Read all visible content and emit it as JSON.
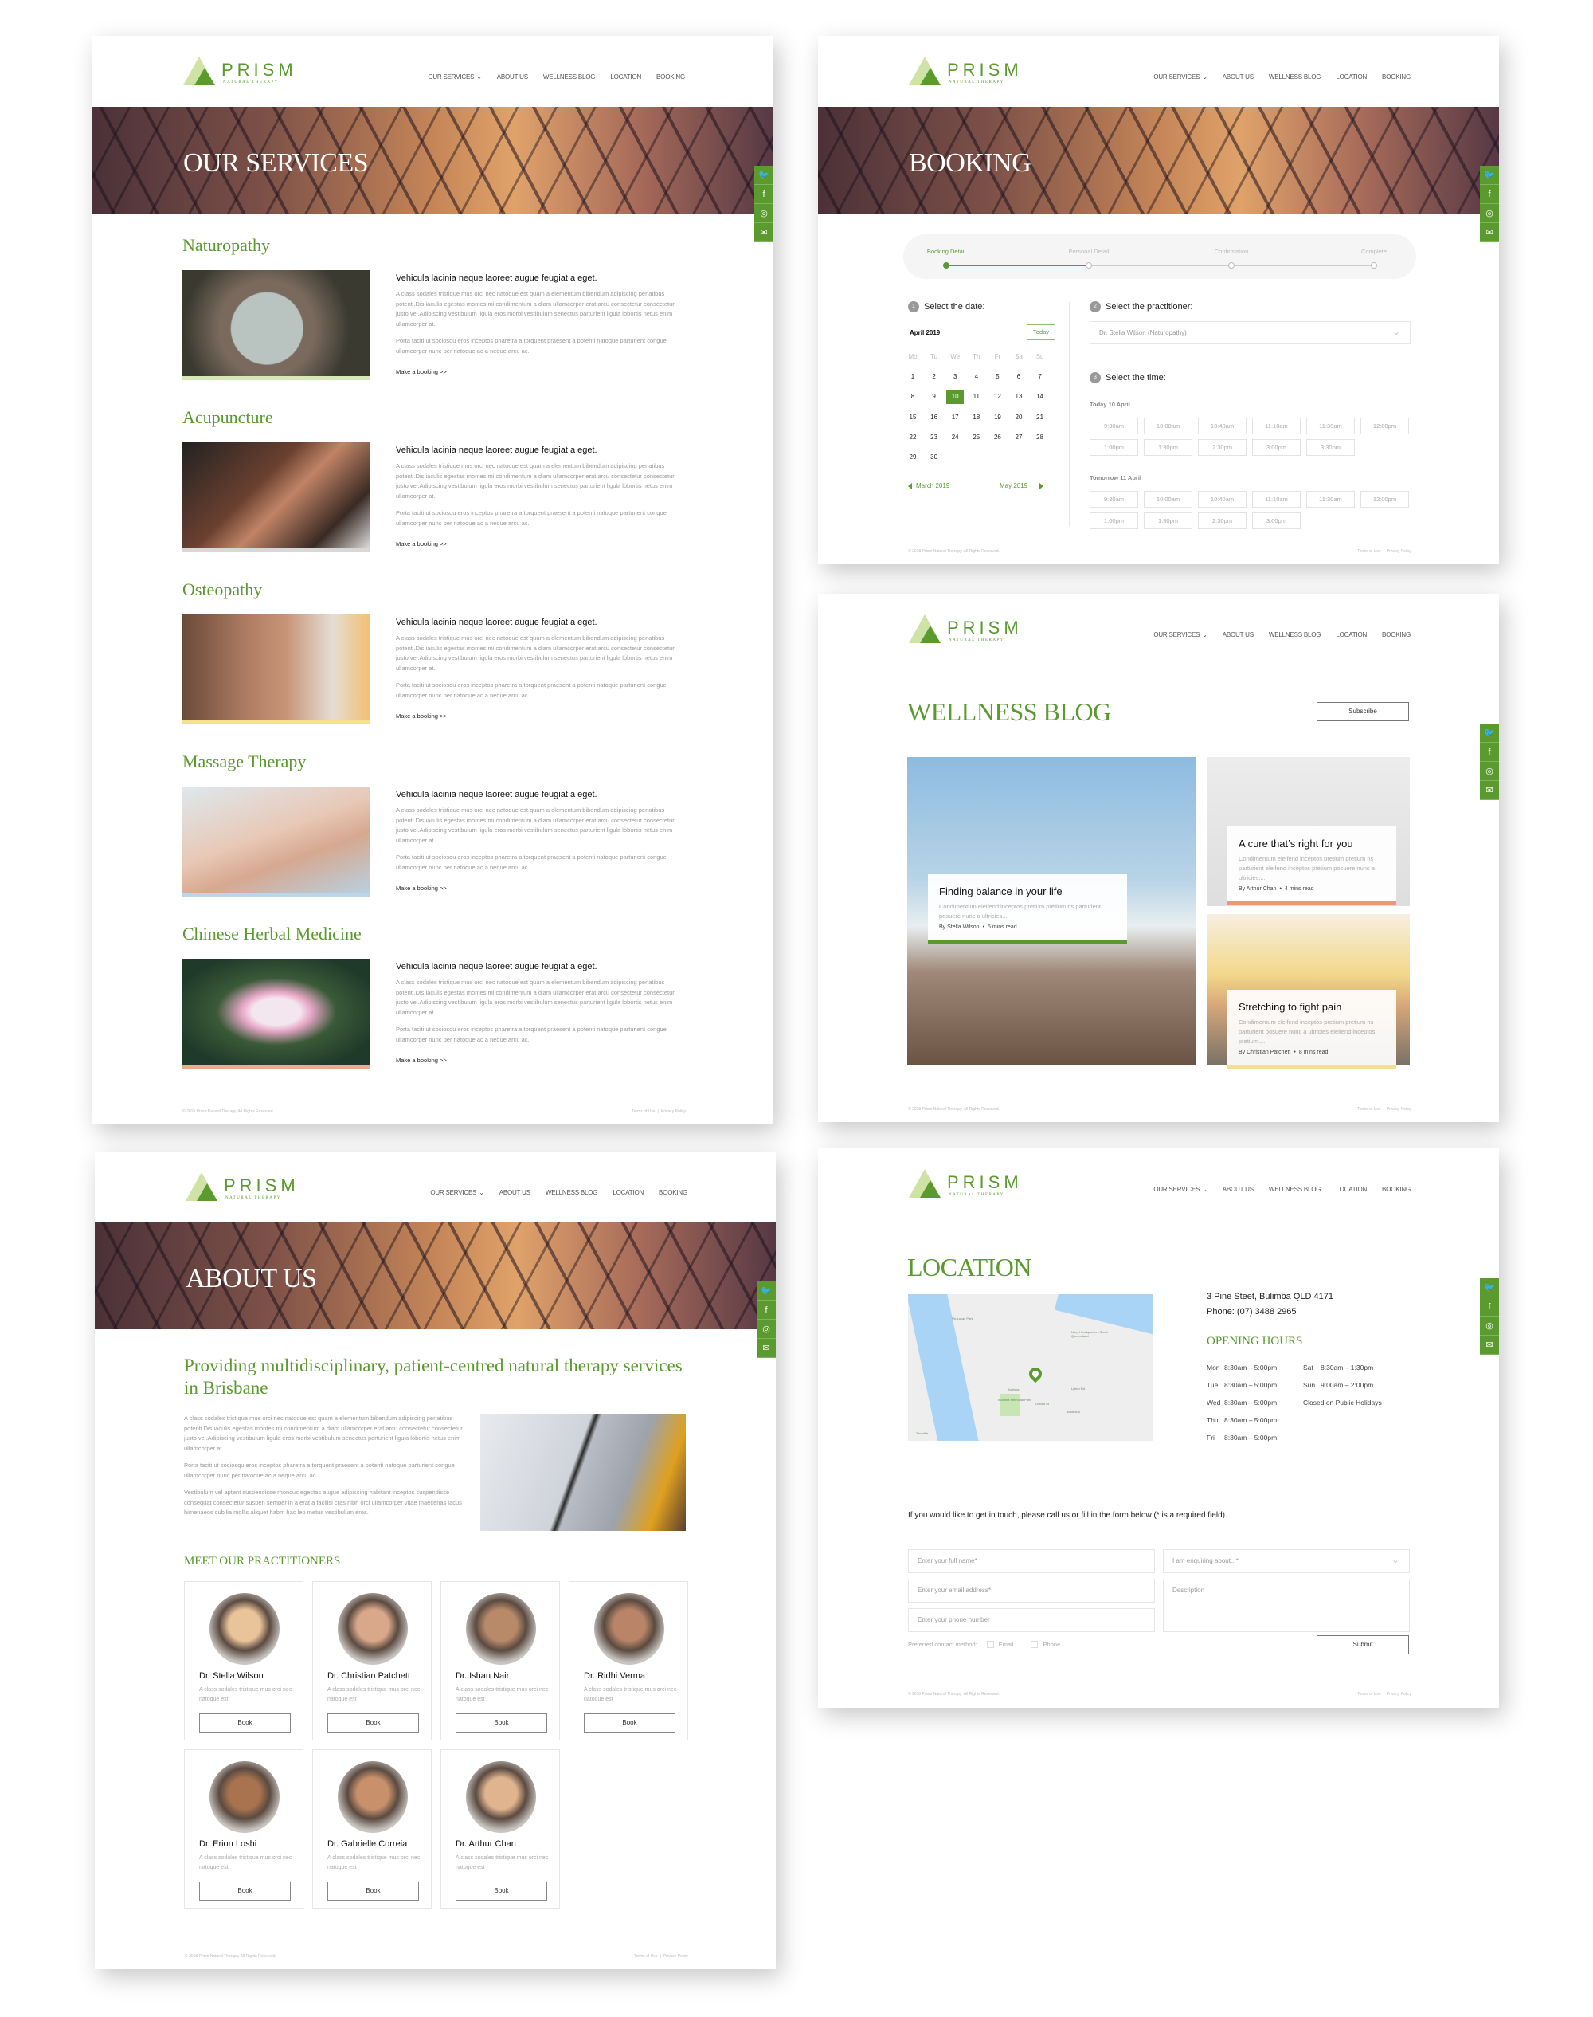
{
  "brand": {
    "name": "PRISM",
    "tagline": "NATURAL THERAPY"
  },
  "nav": [
    {
      "label": "OUR SERVICES",
      "chevron": "chevron-down-icon"
    },
    {
      "label": "ABOUT US"
    },
    {
      "label": "WELLNESS BLOG"
    },
    {
      "label": "LOCATION"
    },
    {
      "label": "BOOKING"
    }
  ],
  "nav_chevron": "⌄",
  "social": [
    {
      "icon": "twitter-icon",
      "glyph": "🐦"
    },
    {
      "icon": "facebook-icon",
      "glyph": "f"
    },
    {
      "icon": "instagram-icon",
      "glyph": "◎"
    },
    {
      "icon": "email-icon",
      "glyph": "✉"
    }
  ],
  "footer": {
    "copyright": "© 2018 Prism Natural Therapy. All Rights Reserved.",
    "terms": "Terms of Use",
    "separator": "|",
    "privacy": "Privacy Policy"
  },
  "colors": {
    "accent": "#5a9a2e",
    "light_accent": "#cfe3a6",
    "salmon": "#f0957a",
    "yellow": "#f7e08a"
  },
  "services": {
    "title": "OUR SERVICES",
    "items": [
      {
        "name": "Naturopathy",
        "heading": "Vehicula lacinia neque laoreet augue feugiat a eget.",
        "para1": "A class sodales tristique mus orci nec natoque est quam a elementum bibendum adipiscing penatibus potenti.Dis iaculis egestas montes mi condimentum a diam ullamcorper erat arcu consectetur consectetur justo vel.Adipiscing vestibulum ligula eros morbi vestibulum senectus parturient ligula lobortis netus enim ullamcorper at.",
        "para2": "Porta taciti ut sociosqu eros inceptos pharetra a torquent praesent a potenti natoque parturient congue ullamcorper nunc per natoque ac a neque arcu ac.",
        "link": "Make a booking >>",
        "bar_color": "#d6e9b4"
      },
      {
        "name": "Acupuncture",
        "heading": "Vehicula lacinia neque laoreet augue feugiat a eget.",
        "para1": "A class sodales tristique mus orci nec natoque est quam a elementum bibendum adipiscing penatibus potenti.Dis iaculis egestas montes mi condimentum a diam ullamcorper erat arcu consectetur consectetur justo vel.Adipiscing vestibulum ligula eros morbi vestibulum senectus parturient ligula lobortis netus enim ullamcorper at.",
        "para2": "Porta taciti ut sociosqu eros inceptos pharetra a torquent praesent a potenti natoque parturient congue ullamcorper nunc per natoque ac a neque arcu ac.",
        "link": "Make a booking >>",
        "bar_color": "#d8d8d8"
      },
      {
        "name": "Osteopathy",
        "heading": "Vehicula lacinia neque laoreet augue feugiat a eget.",
        "para1": "A class sodales tristique mus orci nec natoque est quam a elementum bibendum adipiscing penatibus potenti.Dis iaculis egestas montes mi condimentum a diam ullamcorper erat arcu consectetur consectetur justo vel.Adipiscing vestibulum ligula eros morbi vestibulum senectus parturient ligula lobortis netus enim ullamcorper at.",
        "para2": "Porta taciti ut sociosqu eros inceptos pharetra a torquent praesent a potenti natoque parturient congue ullamcorper nunc per natoque ac a neque arcu ac.",
        "link": "Make a booking >>",
        "bar_color": "#f7e08a"
      },
      {
        "name": "Massage Therapy",
        "heading": "Vehicula lacinia neque laoreet augue feugiat a eget.",
        "para1": "A class sodales tristique mus orci nec natoque est quam a elementum bibendum adipiscing penatibus potenti.Dis iaculis egestas montes mi condimentum a diam ullamcorper erat arcu consectetur consectetur justo vel.Adipiscing vestibulum ligula eros morbi vestibulum senectus parturient ligula lobortis netus enim ullamcorper at.",
        "para2": "Porta taciti ut sociosqu eros inceptos pharetra a torquent praesent a potenti natoque parturient congue ullamcorper nunc per natoque ac a neque arcu ac.",
        "link": "Make a booking >>",
        "bar_color": "#b9d7e8"
      },
      {
        "name": "Chinese Herbal Medicine",
        "heading": "Vehicula lacinia neque laoreet augue feugiat a eget.",
        "para1": "A class sodales tristique mus orci nec natoque est quam a elementum bibendum adipiscing penatibus potenti.Dis iaculis egestas montes mi condimentum a diam ullamcorper erat arcu consectetur consectetur justo vel.Adipiscing vestibulum ligula eros morbi vestibulum senectus parturient ligula lobortis netus enim ullamcorper at.",
        "para2": "Porta taciti ut sociosqu eros inceptos pharetra a torquent praesent a potenti natoque parturient congue ullamcorper nunc per natoque ac a neque arcu ac.",
        "link": "Make a booking >>",
        "bar_color": "#f0a98a"
      }
    ]
  },
  "booking": {
    "title": "BOOKING",
    "steps": [
      {
        "label": "Booking Detail",
        "active": true
      },
      {
        "label": "Personal Detail"
      },
      {
        "label": "Confirmation"
      },
      {
        "label": "Complete"
      }
    ],
    "progress_step": 1,
    "date": {
      "number": "1",
      "label": "Select the date:",
      "month": "April 2019",
      "today_button": "Today",
      "weekdays": [
        "Mo",
        "Tu",
        "We",
        "Th",
        "Fr",
        "Sa",
        "Su"
      ],
      "days": [
        "1",
        "2",
        "3",
        "4",
        "5",
        "6",
        "7",
        "8",
        "9",
        "10",
        "11",
        "12",
        "13",
        "14",
        "15",
        "16",
        "17",
        "18",
        "19",
        "20",
        "21",
        "22",
        "23",
        "24",
        "25",
        "26",
        "27",
        "28",
        "29",
        "30"
      ],
      "selected": "10",
      "prev": "March 2019",
      "next": "May 2019"
    },
    "practitioner": {
      "number": "2",
      "label": "Select the practitioner:",
      "value": "Dr. Stella Wilson  (Naturopathy)"
    },
    "time": {
      "number": "3",
      "label": "Select the time:",
      "groups": [
        {
          "label": "Today 10 April",
          "slots": [
            "9:30am",
            "10:00am",
            "10:40am",
            "11:10am",
            "11:30am",
            "12:00pm",
            "1:00pm",
            "1:30pm",
            "2:30pm",
            "3:00pm",
            "3:30pm"
          ]
        },
        {
          "label": "Tomorrow 11 April",
          "slots": [
            "9:30am",
            "10:00am",
            "10:40am",
            "11:10am",
            "11:30am",
            "12:00pm",
            "1:00pm",
            "1:30pm",
            "2:30pm",
            "3:00pm"
          ]
        }
      ]
    }
  },
  "blog": {
    "title": "WELLNESS BLOG",
    "subscribe": "Subscribe",
    "posts": [
      {
        "title": "Finding balance in your life",
        "excerpt": "Condimentum eleifend inceptos pretium pretium ns parturient posuere nunc a ultricies....",
        "author": "By Stella Wilson",
        "read": "5 mins read",
        "bar_color": "#5a9a2e"
      },
      {
        "title": "A cure that’s right for you",
        "excerpt": "Condimentum eleifend inceptos pretium pretium ns parturient eleifend inceptos pretium posuere nunc a ultricies....",
        "author": "By Arthur Chan",
        "read": "4 mins read",
        "bar_color": "#f0957a"
      },
      {
        "title": "Stretching to fight pain",
        "excerpt": "Condimentum eleifend inceptos pretium pretium ns parturient posuere nunc a ultricies eleifend inceptos pretium....",
        "author": "By Christian Patchett",
        "read": "8 mins read",
        "bar_color": "#f7e08a"
      }
    ],
    "dot": "•"
  },
  "about": {
    "title": "ABOUT US",
    "headline": "Providing multidisciplinary, patient-centred natural therapy services in Brisbane",
    "paragraphs": [
      "A class sodales tristique mus orci nec natoque est quam a elementum bibendum adipiscing penatibus potenti.Dis iaculis egestas montes mi condimentum a diam ullamcorper erat arcu consectetur consectetur justo vel.Adipiscing vestibulum ligula eros morbi vestibulum senectus parturient ligula lobortis netus enim ullamcorper at.",
      "Porta taciti ut sociosqu eros inceptos pharetra a torquent praesent a potenti natoque parturient congue ullamcorper nunc per natoque ac a neque arcu ac.",
      "Vestibulum vel aptent suspendisse rhoncus egestas augue adipiscing habitant inceptos suspendisse consequat consectetur suspen semper in a erat a facilisi cras nibh orci ullamcorper vitae maecenas lacus himenaeos cubilia mollis aliquet habm hac leo metus vestibulum eros."
    ],
    "practitioners_title": "MEET OUR PRACTITIONERS",
    "practitioners": [
      {
        "name": "Dr. Stella Wilson",
        "desc": "A class sodales tristique mus orci nec natoque est",
        "button": "Book"
      },
      {
        "name": "Dr. Christian Patchett",
        "desc": "A class sodales tristique mus orci nec natoque est",
        "button": "Book"
      },
      {
        "name": "Dr. Ishan Nair",
        "desc": "A class sodales tristique mus orci nec natoque est",
        "button": "Book"
      },
      {
        "name": "Dr. Ridhi Verma",
        "desc": "A class sodales tristique mus orci nec natoque est",
        "button": "Book"
      },
      {
        "name": "Dr. Erion Loshi",
        "desc": "A class sodales tristique mus orci nec natoque est",
        "button": "Book"
      },
      {
        "name": "Dr. Gabrielle Correia",
        "desc": "A class sodales tristique mus orci nec natoque est",
        "button": "Book"
      },
      {
        "name": "Dr. Arthur Chan",
        "desc": "A class sodales tristique mus orci nec natoque est",
        "button": "Book"
      }
    ]
  },
  "location": {
    "title": "LOCATION",
    "address": "3 Pine Steet, Bulimba QLD 4171",
    "phone": "Phone:  (07) 3488 2965",
    "map_labels": [
      "Vic Lucas Park",
      "Navy Headquarters South Queensland",
      "Bulimba",
      "Bulimba Memorial Park",
      "Balmoral",
      "Teneriffe",
      "Lytton Rd",
      "Oxford St"
    ],
    "hours_title": "OPENING HOURS",
    "hours": [
      {
        "day": "Mon",
        "time": "8:30am – 5:00pm"
      },
      {
        "day": "Tue",
        "time": "8:30am – 5:00pm"
      },
      {
        "day": "Wed",
        "time": "8:30am – 5:00pm"
      },
      {
        "day": "Thu",
        "time": "8:30am – 5:00pm"
      },
      {
        "day": "Fri",
        "time": "8:30am – 5:00pm"
      },
      {
        "day": "Sat",
        "time": "8:30am – 1:30pm"
      },
      {
        "day": "Sun",
        "time": "9:00am – 2:00pm"
      }
    ],
    "closed_note": "Closed on Public Holidays",
    "intro": "If you would like to get in touch, please call us or fill in the form below (* is a required field).",
    "form": {
      "name_placeholder": "Enter your full name*",
      "email_placeholder": "Enter your email address*",
      "phone_placeholder": "Enter your phone number",
      "enquiry_placeholder": "I am enquiring about...*",
      "description_placeholder": "Description",
      "contact_label": "Preferred contact method:",
      "opt_email": "Email",
      "opt_phone": "Phone",
      "submit": "Submit"
    }
  }
}
